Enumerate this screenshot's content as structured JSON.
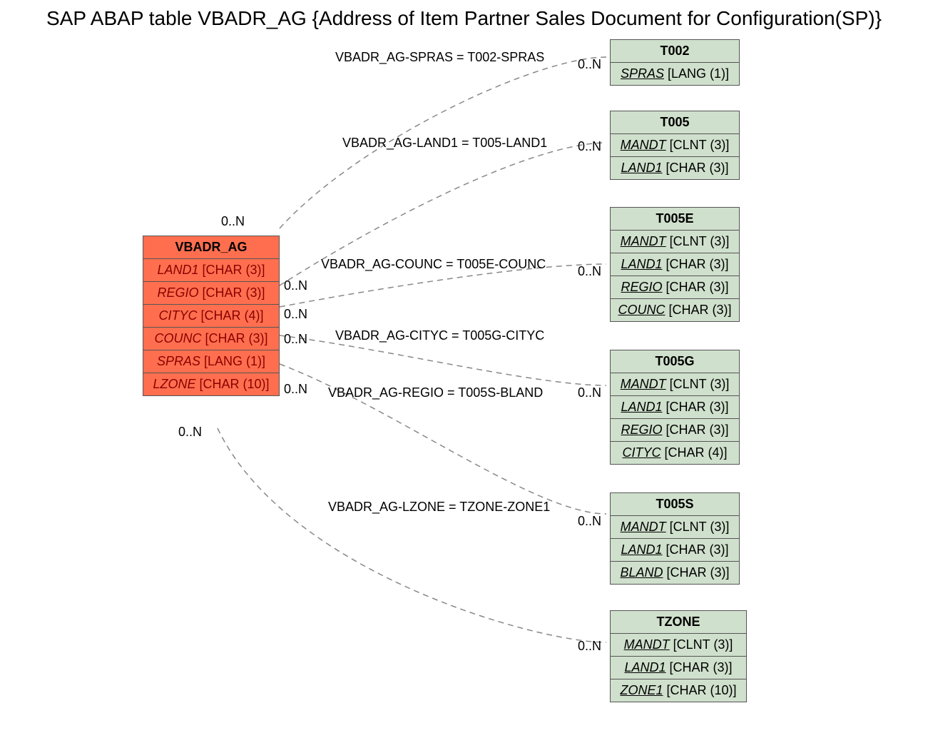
{
  "title": "SAP ABAP table VBADR_AG {Address of Item Partner Sales Document for Configuration(SP)}",
  "main": {
    "name": "VBADR_AG",
    "fields": [
      {
        "name": "LAND1",
        "type": "[CHAR (3)]"
      },
      {
        "name": "REGIO",
        "type": "[CHAR (3)]"
      },
      {
        "name": "CITYC",
        "type": "[CHAR (4)]"
      },
      {
        "name": "COUNC",
        "type": "[CHAR (3)]"
      },
      {
        "name": "SPRAS",
        "type": "[LANG (1)]"
      },
      {
        "name": "LZONE",
        "type": "[CHAR (10)]"
      }
    ]
  },
  "refs": [
    {
      "name": "T002",
      "fields": [
        {
          "name": "SPRAS",
          "type": "[LANG (1)]"
        }
      ]
    },
    {
      "name": "T005",
      "fields": [
        {
          "name": "MANDT",
          "type": "[CLNT (3)]"
        },
        {
          "name": "LAND1",
          "type": "[CHAR (3)]"
        }
      ]
    },
    {
      "name": "T005E",
      "fields": [
        {
          "name": "MANDT",
          "type": "[CLNT (3)]"
        },
        {
          "name": "LAND1",
          "type": "[CHAR (3)]"
        },
        {
          "name": "REGIO",
          "type": "[CHAR (3)]"
        },
        {
          "name": "COUNC",
          "type": "[CHAR (3)]"
        }
      ]
    },
    {
      "name": "T005G",
      "fields": [
        {
          "name": "MANDT",
          "type": "[CLNT (3)]"
        },
        {
          "name": "LAND1",
          "type": "[CHAR (3)]"
        },
        {
          "name": "REGIO",
          "type": "[CHAR (3)]"
        },
        {
          "name": "CITYC",
          "type": "[CHAR (4)]"
        }
      ]
    },
    {
      "name": "T005S",
      "fields": [
        {
          "name": "MANDT",
          "type": "[CLNT (3)]"
        },
        {
          "name": "LAND1",
          "type": "[CHAR (3)]"
        },
        {
          "name": "BLAND",
          "type": "[CHAR (3)]"
        }
      ]
    },
    {
      "name": "TZONE",
      "fields": [
        {
          "name": "MANDT",
          "type": "[CLNT (3)]"
        },
        {
          "name": "LAND1",
          "type": "[CHAR (3)]"
        },
        {
          "name": "ZONE1",
          "type": "[CHAR (10)]"
        }
      ]
    }
  ],
  "relations": [
    {
      "label": "VBADR_AG-SPRAS = T002-SPRAS",
      "left_card": "0..N",
      "right_card": "0..N"
    },
    {
      "label": "VBADR_AG-LAND1 = T005-LAND1",
      "left_card": "0..N",
      "right_card": "0..N"
    },
    {
      "label": "VBADR_AG-COUNC = T005E-COUNC",
      "left_card": "0..N",
      "right_card": "0..N"
    },
    {
      "label": "VBADR_AG-CITYC = T005G-CITYC",
      "left_card": "0..N",
      "right_card": "0..N"
    },
    {
      "label": "VBADR_AG-REGIO = T005S-BLAND",
      "left_card": "0..N",
      "right_card": "0..N"
    },
    {
      "label": "VBADR_AG-LZONE = TZONE-ZONE1",
      "left_card": "0..N",
      "right_card": "0..N"
    }
  ]
}
